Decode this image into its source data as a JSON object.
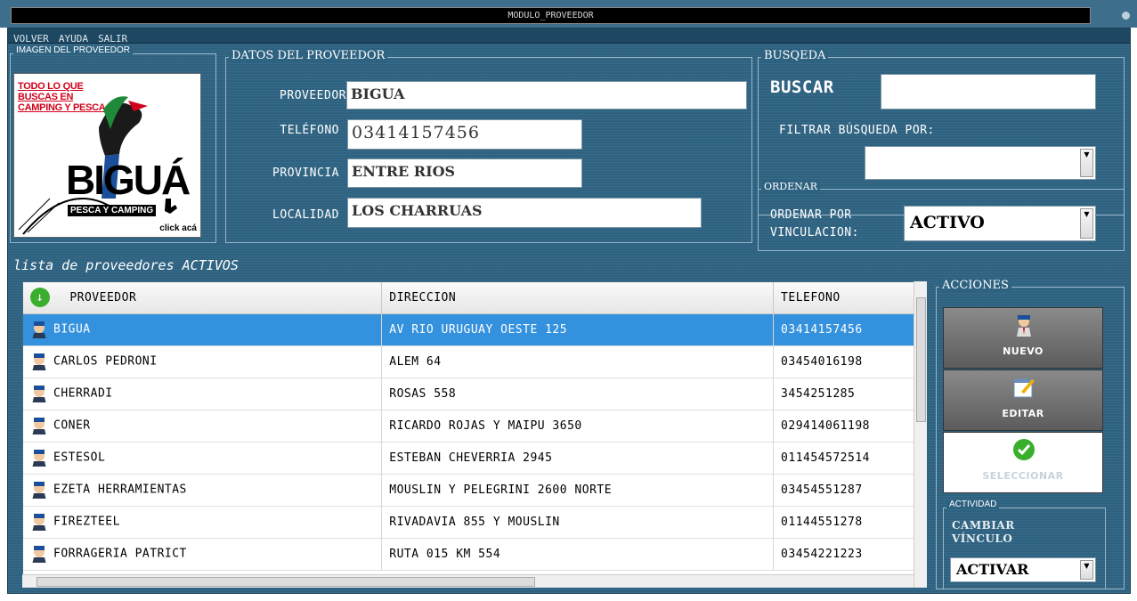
{
  "window": {
    "title": "MODULO_PROVEEDOR"
  },
  "menu": [
    "VOLVER",
    "AYUDA",
    "SALIR"
  ],
  "image_group": {
    "label": "IMAGEN DEL PROVEEDOR",
    "promo": "TODO LO QUE BUSCAS EN CAMPING Y PESCA",
    "brand": "BIGUÁ",
    "sub": "PESCA Y CAMPING",
    "click": "click acá"
  },
  "datos": {
    "label": "DATOS DEL PROVEEDOR",
    "proveedor_label": "PROVEEDOR",
    "proveedor_value": "BIGUA",
    "telefono_label": "TELÉFONO",
    "telefono_value": "03414157456",
    "provincia_label": "PROVINCIA",
    "provincia_value": "ENTRE RIOS",
    "localidad_label": "LOCALIDAD",
    "localidad_value": "LOS CHARRUAS"
  },
  "busqueda": {
    "label": "BUSQEDA",
    "buscar_label": "BUSCAR",
    "filtrar_label": "FILTRAR BÚSQUEDA POR:"
  },
  "ordenar": {
    "label": "ORDENAR",
    "ordenar_label_1": "ORDENAR POR",
    "ordenar_label_2": "VINCULACION:",
    "value": "ACTIVO"
  },
  "list_title": "lista de proveedores ACTIVOS",
  "table": {
    "headers": [
      "PROVEEDOR",
      "DIRECCION",
      "TELEFONO"
    ],
    "rows": [
      [
        "BIGUA",
        "AV RIO URUGUAY OESTE 125",
        "03414157456"
      ],
      [
        "CARLOS PEDRONI",
        "ALEM 64",
        "03454016198"
      ],
      [
        "CHERRADI",
        "ROSAS 558",
        "3454251285"
      ],
      [
        "CONER",
        "RICARDO ROJAS Y MAIPU 3650",
        "029414061198"
      ],
      [
        "ESTESOL",
        "ESTEBAN CHEVERRIA 2945",
        "011454572514"
      ],
      [
        "EZETA HERRAMIENTAS",
        "MOUSLIN Y PELEGRINI 2600 NORTE",
        "03454551287"
      ],
      [
        "FIREZTEEL",
        "RIVADAVIA 855 Y MOUSLIN",
        "01144551278"
      ],
      [
        "FORRAGERIA PATRICT",
        "RUTA 015 KM 554",
        "03454221223"
      ]
    ]
  },
  "acciones": {
    "label": "ACCIONES",
    "nuevo": "NUEVO",
    "editar": "EDITAR",
    "seleccionar": "SELECCIONAR"
  },
  "actividad": {
    "label": "ACTIVIDAD",
    "cambiar_1": "CAMBIAR",
    "cambiar_2": "VÍNCULO",
    "value": "ACTIVAR"
  },
  "colors": {
    "bg": "#2e6281",
    "selection": "#3391dd",
    "promo_red": "#d0021b"
  }
}
